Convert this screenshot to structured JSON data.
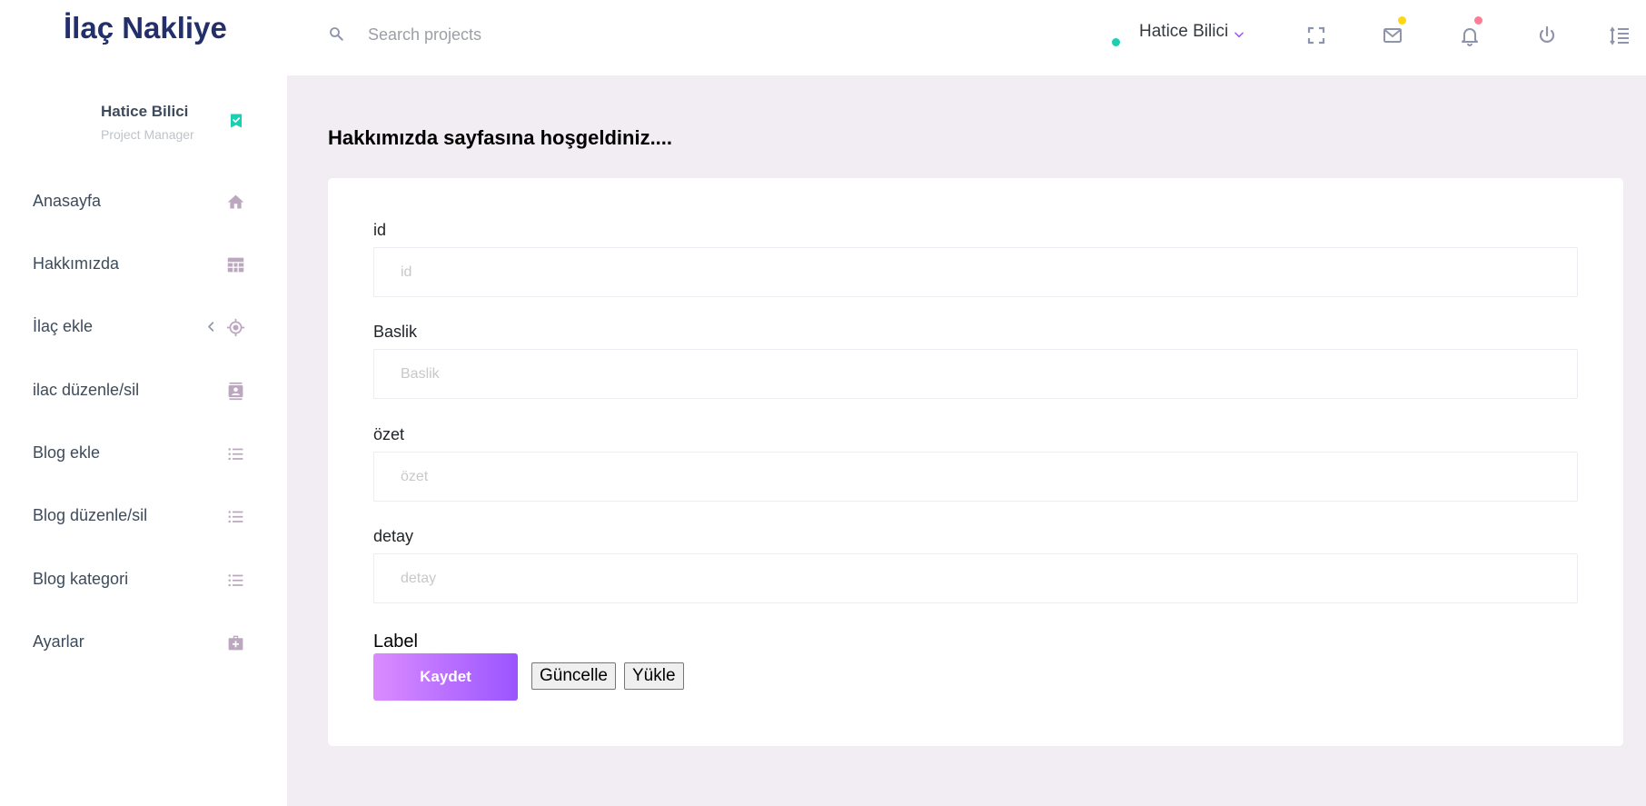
{
  "brand": "İlaç Nakliye",
  "search": {
    "placeholder": "Search projects"
  },
  "navbar": {
    "profile_name": "Hatice Bilici",
    "online_color": "#1bcfb4",
    "icons": [
      "fullscreen-icon",
      "mail-icon",
      "bell-icon",
      "power-icon",
      "menu-icon"
    ],
    "mail_badge_color": "#fed713",
    "bell_badge_color": "#fe7c96"
  },
  "sidebar": {
    "profile": {
      "name": "Hatice Bilici",
      "role": "Project Manager"
    },
    "items": [
      {
        "label": "Anasayfa",
        "icon": "home-icon"
      },
      {
        "label": "Hakkımızda",
        "icon": "table-icon"
      },
      {
        "label": "İlaç ekle",
        "icon": "crosshairs-gps-icon",
        "has_submenu": true
      },
      {
        "label": "ilac düzenle/sil",
        "icon": "contacts-icon"
      },
      {
        "label": "Blog ekle",
        "icon": "format-list-bulleted-icon"
      },
      {
        "label": "Blog düzenle/sil",
        "icon": "format-list-bulleted-icon"
      },
      {
        "label": "Blog kategori",
        "icon": "format-list-bulleted-icon"
      },
      {
        "label": "Ayarlar",
        "icon": "medical-bag-icon"
      }
    ]
  },
  "main": {
    "page_title": "Hakkımızda sayfasına hoşgeldiniz....",
    "form": {
      "fields": [
        {
          "label": "id",
          "placeholder": "id",
          "value": ""
        },
        {
          "label": "Baslik",
          "placeholder": "Baslik",
          "value": ""
        },
        {
          "label": "özet",
          "placeholder": "özet",
          "value": ""
        },
        {
          "label": "detay",
          "placeholder": "detay",
          "value": ""
        }
      ],
      "extra_label": "Label",
      "save_label": "Kaydet",
      "update_label": "Güncelle",
      "load_label": "Yükle"
    }
  },
  "colors": {
    "accent_gradient_start": "#da8cff",
    "accent_gradient_end": "#9a55ff",
    "sidebar_icon": "#bba8bf",
    "brand": "#232f6a"
  }
}
